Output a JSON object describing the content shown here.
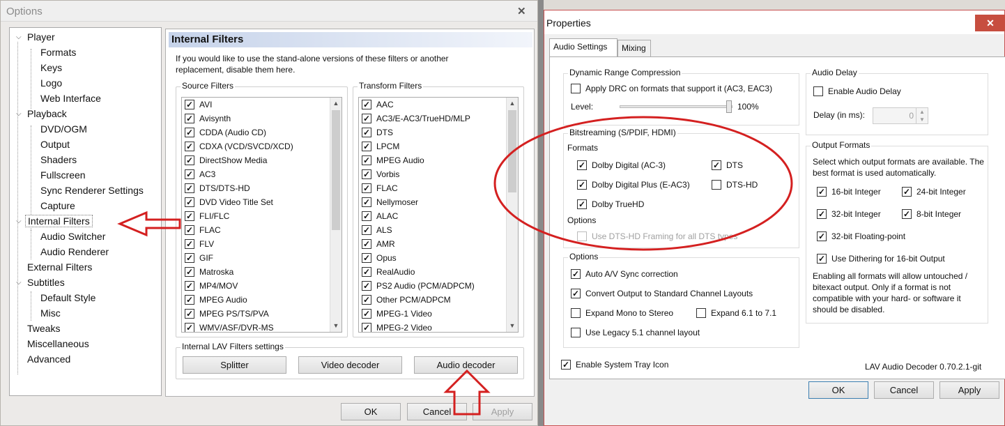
{
  "options": {
    "title": "Options",
    "close": "✕",
    "tree": {
      "player": "Player",
      "formats": "Formats",
      "keys": "Keys",
      "logo": "Logo",
      "web": "Web Interface",
      "playback": "Playback",
      "dvd": "DVD/OGM",
      "output": "Output",
      "shaders": "Shaders",
      "fullscreen": "Fullscreen",
      "sync": "Sync Renderer Settings",
      "capture": "Capture",
      "internal": "Internal Filters",
      "audioswitch": "Audio Switcher",
      "audiorend": "Audio Renderer",
      "external": "External Filters",
      "subtitles": "Subtitles",
      "defstyle": "Default Style",
      "misc": "Misc",
      "tweaks": "Tweaks",
      "miscellaneous": "Miscellaneous",
      "advanced": "Advanced"
    },
    "panel": {
      "title": "Internal Filters",
      "intro": "If you would like to use the stand-alone versions of these filters or another replacement, disable them here.",
      "source_label": "Source Filters",
      "transform_label": "Transform Filters",
      "source": [
        "AVI",
        "Avisynth",
        "CDDA (Audio CD)",
        "CDXA (VCD/SVCD/XCD)",
        "DirectShow Media",
        "AC3",
        "DTS/DTS-HD",
        "DVD Video Title Set",
        "FLI/FLC",
        "FLAC",
        "FLV",
        "GIF",
        "Matroska",
        "MP4/MOV",
        "MPEG Audio",
        "MPEG PS/TS/PVA",
        "WMV/ASF/DVR-MS"
      ],
      "transform": [
        "AAC",
        "AC3/E-AC3/TrueHD/MLP",
        "DTS",
        "LPCM",
        "MPEG Audio",
        "Vorbis",
        "FLAC",
        "Nellymoser",
        "ALAC",
        "ALS",
        "AMR",
        "Opus",
        "RealAudio",
        "PS2 Audio (PCM/ADPCM)",
        "Other PCM/ADPCM",
        "MPEG-1 Video",
        "MPEG-2 Video"
      ],
      "lav_label": "Internal LAV Filters settings",
      "splitter": "Splitter",
      "video": "Video decoder",
      "audio": "Audio decoder"
    },
    "ok": "OK",
    "cancel": "Cancel",
    "apply": "Apply"
  },
  "props": {
    "title": "Properties",
    "close": "✕",
    "tab1": "Audio Settings",
    "tab2": "Mixing",
    "drc": {
      "label": "Dynamic Range Compression",
      "apply": "Apply DRC on formats that support it (AC3, EAC3)",
      "level": "Level:",
      "level_value": "100%",
      "level_pct": 1.0
    },
    "delay": {
      "label": "Audio Delay",
      "enable": "Enable Audio Delay",
      "ms": "Delay (in ms):",
      "value": "0"
    },
    "bits": {
      "label": "Bitstreaming (S/PDIF, HDMI)",
      "formats": "Formats",
      "ac3": "Dolby Digital (AC-3)",
      "dts": "DTS",
      "ddplus": "Dolby Digital Plus (E-AC3)",
      "dtshd": "DTS-HD",
      "truehd": "Dolby TrueHD",
      "options": "Options",
      "framing": "Use DTS-HD Framing for all DTS types"
    },
    "out": {
      "label": "Output Formats",
      "desc": "Select which output formats are available. The best format is used automatically.",
      "i16": "16-bit Integer",
      "i24": "24-bit Integer",
      "i32": "32-bit Integer",
      "i8": "8-bit Integer",
      "f32": "32-bit Floating-point",
      "dither": "Use Dithering for 16-bit Output",
      "note": "Enabling all formats will allow untouched / bitexact output. Only if a format is not compatible with your hard- or software it should be disabled."
    },
    "opt": {
      "label": "Options",
      "av": "Auto A/V Sync correction",
      "convert": "Convert Output to Standard Channel Layouts",
      "mono": "Expand Mono to Stereo",
      "e61": "Expand 6.1 to 7.1",
      "legacy": "Use Legacy 5.1 channel layout"
    },
    "tray": "Enable System Tray Icon",
    "version": "LAV Audio Decoder 0.70.2.1-git",
    "ok": "OK",
    "cancel": "Cancel",
    "apply": "Apply"
  }
}
